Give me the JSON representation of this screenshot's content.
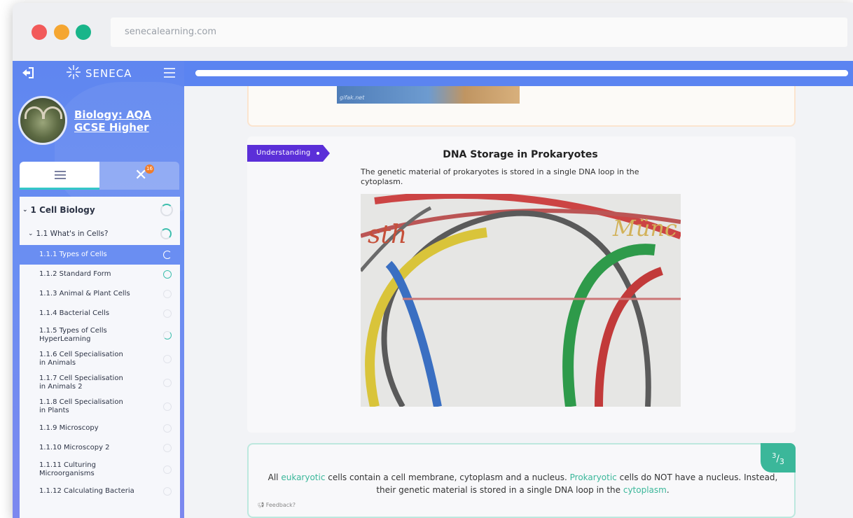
{
  "browser": {
    "url": "senecalearning.com"
  },
  "sidebar": {
    "logo_text": "SENECA",
    "course_title": "Biology: AQA GCSE Higher",
    "wrong_count": "16",
    "toc": [
      {
        "level": 1,
        "label": "1 Cell Biology"
      },
      {
        "level": 2,
        "label": "1.1 What's in Cells?"
      },
      {
        "level": 3,
        "label": "1.1.1 Types of Cells",
        "active": true
      },
      {
        "level": 3,
        "label": "1.1.2 Standard Form"
      },
      {
        "level": 3,
        "label": "1.1.3 Animal & Plant Cells"
      },
      {
        "level": 3,
        "label": "1.1.4 Bacterial Cells"
      },
      {
        "level": 3,
        "label": "1.1.5 Types of Cells HyperLearning"
      },
      {
        "level": 3,
        "label": "1.1.6 Cell Specialisation in Animals"
      },
      {
        "level": 3,
        "label": "1.1.7 Cell Specialisation in Animals 2"
      },
      {
        "level": 3,
        "label": "1.1.8 Cell Specialisation in Plants"
      },
      {
        "level": 3,
        "label": "1.1.9 Microscopy"
      },
      {
        "level": 3,
        "label": "1.1.10 Microscopy 2"
      },
      {
        "level": 3,
        "label": "1.1.11 Culturing Microorganisms"
      },
      {
        "level": 3,
        "label": "1.1.12 Calculating Bacteria"
      }
    ]
  },
  "main": {
    "progress": 1.0,
    "gif_watermark": "gifak.net",
    "card": {
      "tag": "Understanding",
      "title": "DNA Storage in Prokaryotes",
      "description": "The genetic material of prokaryotes is stored in a single DNA loop in the cytoplasm."
    },
    "summary": {
      "counter_num": "3",
      "counter_den": "3",
      "t1": "All ",
      "h1": "eukaryotic",
      "t2": " cells contain a cell membrane, cytoplasm and a nucleus. ",
      "h2": "Prokaryotic",
      "t3": " cells do NOT have a nucleus. Instead, their genetic material is stored in a single DNA loop in the ",
      "h3": "cytoplasm",
      "t4": ".",
      "feedback": "Feedback?"
    }
  },
  "colors": {
    "brand": "#5b84f1",
    "accent": "#3bb79a",
    "tag": "#5b2fd8",
    "badge": "#f07d2c"
  }
}
